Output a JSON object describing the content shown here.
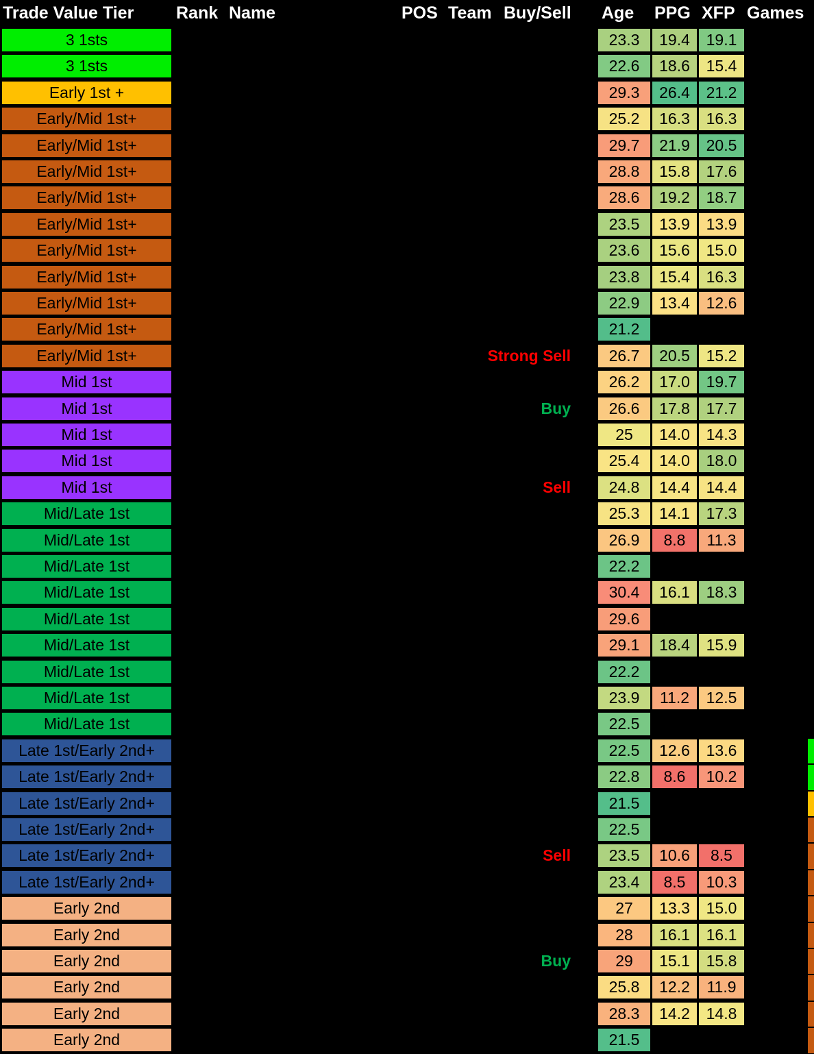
{
  "table": {
    "title": "Trade Value Tier",
    "columns": [
      "Trade Value Tier",
      "Rank",
      "Name",
      "POS",
      "Team",
      "Buy/Sell",
      "Age",
      "PPG",
      "XFP",
      "Games"
    ],
    "colors": {
      "tier_3_1sts": "#00EE00",
      "tier_early_1st_plus": "#FFC000",
      "tier_early_mid_1st_plus": "#C55A11",
      "tier_mid_1st": "#9933FF",
      "tier_mid_late_1st": "#00B050",
      "tier_late_1st_early_2nd_plus": "#2E5597",
      "tier_early_2nd": "#F4B183",
      "buy_text": "#00B050",
      "sell_text": "#FF0000",
      "background": "#000000",
      "header_text": "#FFFFFF"
    },
    "rows": [
      {
        "tier": "3 1sts",
        "tier_color": "#00EE00",
        "buysell": "",
        "age": "23.3",
        "age_color": "#A9D080",
        "ppg": "19.4",
        "ppg_color": "#ADD07F",
        "xfp": "19.1",
        "xfp_color": "#80C983"
      },
      {
        "tier": "3 1sts",
        "tier_color": "#00EE00",
        "buysell": "",
        "age": "22.6",
        "age_color": "#82CA84",
        "ppg": "18.6",
        "ppg_color": "#B7D37F",
        "xfp": "15.4",
        "xfp_color": "#EDE684"
      },
      {
        "tier": "Early 1st +",
        "tier_color": "#FFC000",
        "buysell": "",
        "age": "29.3",
        "age_color": "#F8A07A",
        "ppg": "26.4",
        "ppg_color": "#54BE8A",
        "xfp": "21.2",
        "xfp_color": "#5CC088"
      },
      {
        "tier": "Early/Mid 1st+",
        "tier_color": "#C55A11",
        "buysell": "",
        "age": "25.2",
        "age_color": "#F6E284",
        "ppg": "16.3",
        "ppg_color": "#D6DE81",
        "xfp": "16.3",
        "xfp_color": "#D9DF81"
      },
      {
        "tier": "Early/Mid 1st+",
        "tier_color": "#C55A11",
        "buysell": "",
        "age": "29.7",
        "age_color": "#F89C79",
        "ppg": "21.9",
        "ppg_color": "#8BCC84",
        "xfp": "20.5",
        "xfp_color": "#66C387"
      },
      {
        "tier": "Early/Mid 1st+",
        "tier_color": "#C55A11",
        "buysell": "",
        "age": "28.8",
        "age_color": "#F9A87B",
        "ppg": "15.8",
        "ppg_color": "#E4E382",
        "xfp": "17.6",
        "xfp_color": "#B3D27F"
      },
      {
        "tier": "Early/Mid 1st+",
        "tier_color": "#C55A11",
        "buysell": "",
        "age": "28.6",
        "age_color": "#F9AB7C",
        "ppg": "19.2",
        "ppg_color": "#AFD17F",
        "xfp": "18.7",
        "xfp_color": "#92CE82"
      },
      {
        "tier": "Early/Mid 1st+",
        "tier_color": "#C55A11",
        "buysell": "",
        "age": "23.5",
        "age_color": "#ADD280",
        "ppg": "13.9",
        "ppg_color": "#F9E585",
        "xfp": "13.9",
        "xfp_color": "#FBDB84"
      },
      {
        "tier": "Early/Mid 1st+",
        "tier_color": "#C55A11",
        "buysell": "",
        "age": "23.6",
        "age_color": "#AAD180",
        "ppg": "15.6",
        "ppg_color": "#E9E583",
        "xfp": "15.0",
        "xfp_color": "#F0E784"
      },
      {
        "tier": "Early/Mid 1st+",
        "tier_color": "#C55A11",
        "buysell": "",
        "age": "23.8",
        "age_color": "#A5CF80",
        "ppg": "15.4",
        "ppg_color": "#EBE683",
        "xfp": "16.3",
        "xfp_color": "#D9DF81"
      },
      {
        "tier": "Early/Mid 1st+",
        "tier_color": "#C55A11",
        "buysell": "",
        "age": "22.9",
        "age_color": "#8DCB83",
        "ppg": "13.4",
        "ppg_color": "#FCE185",
        "xfp": "12.6",
        "xfp_color": "#F9BE80"
      },
      {
        "tier": "Early/Mid 1st+",
        "tier_color": "#C55A11",
        "buysell": "",
        "age": "21.2",
        "age_color": "#53BD8A",
        "ppg": "",
        "ppg_color": "",
        "xfp": "",
        "xfp_color": ""
      },
      {
        "tier": "Early/Mid 1st+",
        "tier_color": "#C55A11",
        "buysell": "Strong Sell",
        "age": "26.7",
        "age_color": "#FBC981",
        "ppg": "20.5",
        "ppg_color": "#9ECF81",
        "xfp": "15.2",
        "xfp_color": "#EEE684"
      },
      {
        "tier": "Mid 1st",
        "tier_color": "#9933FF",
        "buysell": "",
        "age": "26.2",
        "age_color": "#FCD282",
        "ppg": "17.0",
        "ppg_color": "#C9DB80",
        "xfp": "19.7",
        "xfp_color": "#73C685"
      },
      {
        "tier": "Mid 1st",
        "tier_color": "#9933FF",
        "buysell": "Buy",
        "age": "26.6",
        "age_color": "#FBCA81",
        "ppg": "17.8",
        "ppg_color": "#BCD57F",
        "xfp": "17.7",
        "xfp_color": "#B0D17F"
      },
      {
        "tier": "Mid 1st",
        "tier_color": "#9933FF",
        "buysell": "",
        "age": "25",
        "age_color": "#EFE784",
        "ppg": "14.0",
        "ppg_color": "#F9E585",
        "xfp": "14.3",
        "xfp_color": "#F8E384"
      },
      {
        "tier": "Mid 1st",
        "tier_color": "#9933FF",
        "buysell": "",
        "age": "25.4",
        "age_color": "#F9E485",
        "ppg": "14.0",
        "ppg_color": "#F9E585",
        "xfp": "18.0",
        "xfp_color": "#A8CF7F"
      },
      {
        "tier": "Mid 1st",
        "tier_color": "#9933FF",
        "buysell": "Sell",
        "age": "24.8",
        "age_color": "#DCE182",
        "ppg": "14.4",
        "ppg_color": "#F7E585",
        "xfp": "14.4",
        "xfp_color": "#F7E384"
      },
      {
        "tier": "Mid/Late 1st",
        "tier_color": "#00B050",
        "buysell": "",
        "age": "25.3",
        "age_color": "#F7E384",
        "ppg": "14.1",
        "ppg_color": "#F9E585",
        "xfp": "17.3",
        "xfp_color": "#B9D47F"
      },
      {
        "tier": "Mid/Late 1st",
        "tier_color": "#00B050",
        "buysell": "",
        "age": "26.9",
        "age_color": "#FBC681",
        "ppg": "8.8",
        "ppg_color": "#F2726A",
        "xfp": "11.3",
        "xfp_color": "#F8A87B"
      },
      {
        "tier": "Mid/Late 1st",
        "tier_color": "#00B050",
        "buysell": "",
        "age": "22.2",
        "age_color": "#6CC486",
        "ppg": "",
        "ppg_color": "",
        "xfp": "",
        "xfp_color": ""
      },
      {
        "tier": "Mid/Late 1st",
        "tier_color": "#00B050",
        "buysell": "",
        "age": "30.4",
        "age_color": "#F88C78",
        "ppg": "16.1",
        "ppg_color": "#D9DF81",
        "xfp": "18.3",
        "xfp_color": "#9DCE81"
      },
      {
        "tier": "Mid/Late 1st",
        "tier_color": "#00B050",
        "buysell": "",
        "age": "29.6",
        "age_color": "#F89D79",
        "ppg": "",
        "ppg_color": "",
        "xfp": "",
        "xfp_color": ""
      },
      {
        "tier": "Mid/Late 1st",
        "tier_color": "#00B050",
        "buysell": "",
        "age": "29.1",
        "age_color": "#F8A37A",
        "ppg": "18.4",
        "ppg_color": "#B9D47F",
        "xfp": "15.9",
        "xfp_color": "#DFE282"
      },
      {
        "tier": "Mid/Late 1st",
        "tier_color": "#00B050",
        "buysell": "",
        "age": "22.2",
        "age_color": "#6CC486",
        "ppg": "",
        "ppg_color": "",
        "xfp": "",
        "xfp_color": ""
      },
      {
        "tier": "Mid/Late 1st",
        "tier_color": "#00B050",
        "buysell": "",
        "age": "23.9",
        "age_color": "#C3D981",
        "ppg": "11.2",
        "ppg_color": "#F9A87B",
        "xfp": "12.5",
        "xfp_color": "#FBC981"
      },
      {
        "tier": "Mid/Late 1st",
        "tier_color": "#00B050",
        "buysell": "",
        "age": "22.5",
        "age_color": "#79C885",
        "ppg": "",
        "ppg_color": "",
        "xfp": "",
        "xfp_color": ""
      },
      {
        "tier": "Late 1st/Early 2nd+",
        "tier_color": "#2E5597",
        "buysell": "",
        "age": "22.5",
        "age_color": "#79C885",
        "ppg": "12.6",
        "ppg_color": "#FBCD82",
        "xfp": "13.6",
        "xfp_color": "#FCD983"
      },
      {
        "tier": "Late 1st/Early 2nd+",
        "tier_color": "#2E5597",
        "buysell": "",
        "age": "22.8",
        "age_color": "#8BCB83",
        "ppg": "8.6",
        "ppg_color": "#F2706A",
        "xfp": "10.2",
        "xfp_color": "#F89679"
      },
      {
        "tier": "Late 1st/Early 2nd+",
        "tier_color": "#2E5597",
        "buysell": "",
        "age": "21.5",
        "age_color": "#54BE8A",
        "ppg": "",
        "ppg_color": "",
        "xfp": "",
        "xfp_color": ""
      },
      {
        "tier": "Late 1st/Early 2nd+",
        "tier_color": "#2E5597",
        "buysell": "",
        "age": "22.5",
        "age_color": "#79C885",
        "ppg": "",
        "ppg_color": "",
        "xfp": "",
        "xfp_color": ""
      },
      {
        "tier": "Late 1st/Early 2nd+",
        "tier_color": "#2E5597",
        "buysell": "Sell",
        "age": "23.5",
        "age_color": "#ADD280",
        "ppg": "10.6",
        "ppg_color": "#F8A17A",
        "xfp": "8.5",
        "xfp_color": "#F2706A"
      },
      {
        "tier": "Late 1st/Early 2nd+",
        "tier_color": "#2E5597",
        "buysell": "",
        "age": "23.4",
        "age_color": "#AFD280",
        "ppg": "8.5",
        "ppg_color": "#F2706A",
        "xfp": "10.3",
        "xfp_color": "#F89A79"
      },
      {
        "tier": "Early 2nd",
        "tier_color": "#F4B183",
        "buysell": "",
        "age": "27",
        "age_color": "#FCC881",
        "ppg": "13.3",
        "ppg_color": "#FCE185",
        "xfp": "15.0",
        "xfp_color": "#EFE784"
      },
      {
        "tier": "Early 2nd",
        "tier_color": "#F4B183",
        "buysell": "",
        "age": "28",
        "age_color": "#FAB67E",
        "ppg": "16.1",
        "ppg_color": "#D9DF81",
        "xfp": "16.1",
        "xfp_color": "#DDE182"
      },
      {
        "tier": "Early 2nd",
        "tier_color": "#F4B183",
        "buysell": "Buy",
        "age": "29",
        "age_color": "#F8A47A",
        "ppg": "15.1",
        "ppg_color": "#EDE684",
        "xfp": "15.8",
        "xfp_color": "#D3DD81"
      },
      {
        "tier": "Early 2nd",
        "tier_color": "#F4B183",
        "buysell": "",
        "age": "25.8",
        "age_color": "#FBDC83",
        "ppg": "12.2",
        "ppg_color": "#FABE80",
        "xfp": "11.9",
        "xfp_color": "#F8B27D"
      },
      {
        "tier": "Early 2nd",
        "tier_color": "#F4B183",
        "buysell": "",
        "age": "28.3",
        "age_color": "#F9B27D",
        "ppg": "14.2",
        "ppg_color": "#F9E585",
        "xfp": "14.8",
        "xfp_color": "#F3E784"
      },
      {
        "tier": "Early 2nd",
        "tier_color": "#F4B183",
        "buysell": "",
        "age": "21.5",
        "age_color": "#54BE8A",
        "ppg": "",
        "ppg_color": "",
        "xfp": "",
        "xfp_color": ""
      }
    ],
    "right_edge_sliver": [
      {
        "index": 27,
        "color": "#00EE00"
      },
      {
        "index": 28,
        "color": "#00EE00"
      },
      {
        "index": 29,
        "color": "#FFC000"
      },
      {
        "index": 30,
        "color": "#C55A11"
      },
      {
        "index": 31,
        "color": "#C55A11"
      },
      {
        "index": 32,
        "color": "#C55A11"
      },
      {
        "index": 33,
        "color": "#C55A11"
      },
      {
        "index": 34,
        "color": "#C55A11"
      },
      {
        "index": 35,
        "color": "#C55A11"
      },
      {
        "index": 36,
        "color": "#C55A11"
      },
      {
        "index": 37,
        "color": "#C55A11"
      },
      {
        "index": 38,
        "color": "#C55A11"
      }
    ]
  }
}
